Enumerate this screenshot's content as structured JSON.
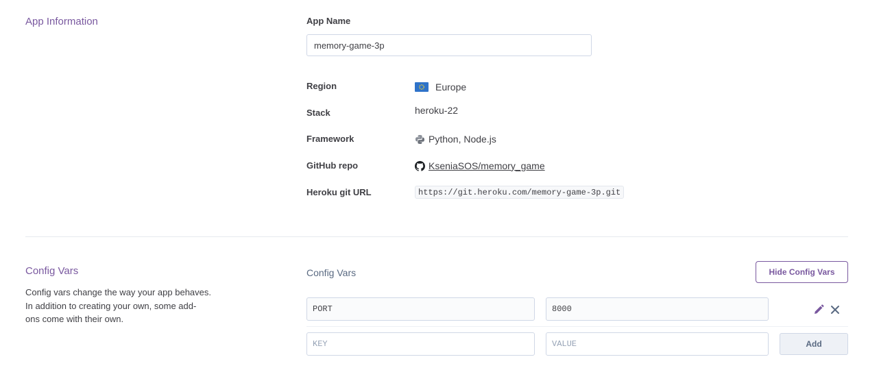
{
  "app_info": {
    "section_title": "App Information",
    "app_name_label": "App Name",
    "app_name_value": "memory-game-3p",
    "rows": {
      "region_label": "Region",
      "region_value": "Europe",
      "stack_label": "Stack",
      "stack_value": "heroku-22",
      "framework_label": "Framework",
      "framework_value": "Python, Node.js",
      "github_label": "GitHub repo",
      "github_value": "KseniaSOS/memory_game",
      "git_url_label": "Heroku git URL",
      "git_url_value": "https://git.heroku.com/memory-game-3p.git"
    }
  },
  "config_vars": {
    "section_title": "Config Vars",
    "description_line1": "Config vars change the way your app behaves.",
    "description_line2": "In addition to creating your own, some add-",
    "description_line3": "ons come with their own.",
    "panel_title": "Config Vars",
    "hide_button": "Hide Config Vars",
    "vars": [
      {
        "key": "PORT",
        "value": "8000"
      }
    ],
    "new_key_placeholder": "KEY",
    "new_value_placeholder": "VALUE",
    "add_button": "Add"
  },
  "icons": {
    "region": "eu-flag-icon",
    "framework": "python-icon",
    "github": "github-icon",
    "edit": "pencil-icon",
    "delete": "close-icon"
  },
  "colors": {
    "accent": "#79589f",
    "text": "#3f3f44",
    "border": "#cfd7e6"
  }
}
